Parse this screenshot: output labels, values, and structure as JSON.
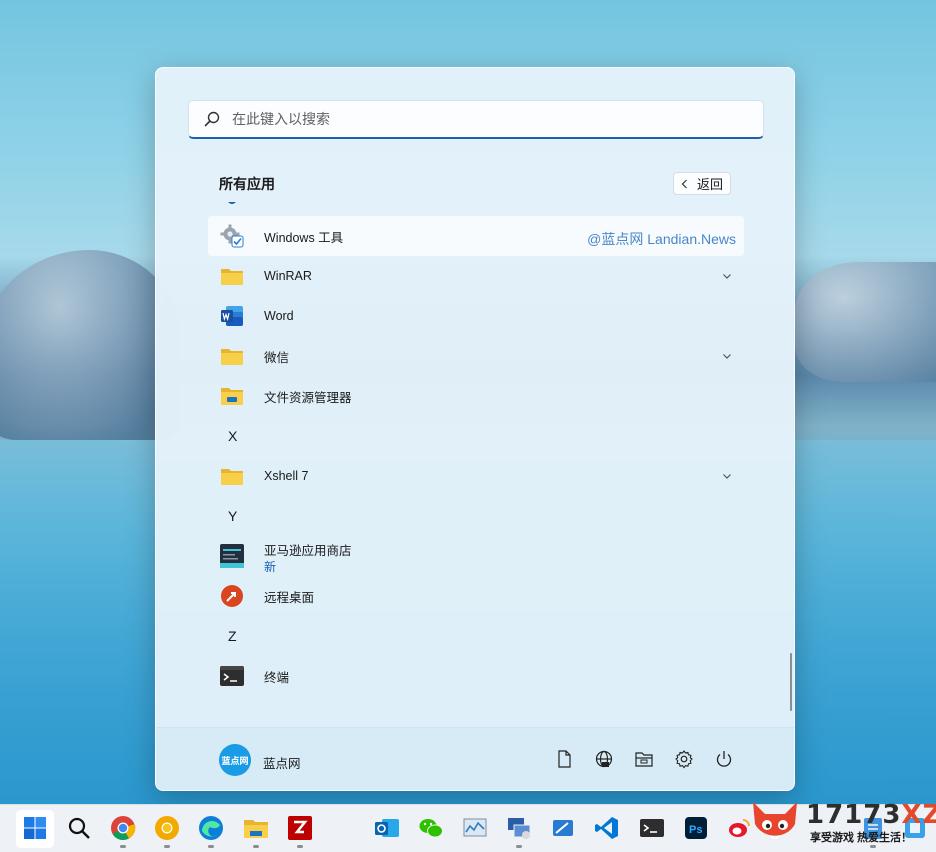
{
  "search": {
    "placeholder": "在此键入以搜索"
  },
  "all_apps": {
    "title": "所有应用",
    "back_label": "返回"
  },
  "apps": [
    {
      "label": "Windows 工具",
      "icon": "gear-tools-icon"
    },
    {
      "label": "WinRAR",
      "icon": "folder-icon",
      "expandable": true
    },
    {
      "label": "Word",
      "icon": "word-icon"
    },
    {
      "label": "微信",
      "icon": "folder-icon",
      "expandable": true
    },
    {
      "label": "文件资源管理器",
      "icon": "file-explorer-icon"
    },
    {
      "letter": "X"
    },
    {
      "label": "Xshell 7",
      "icon": "folder-icon",
      "expandable": true
    },
    {
      "letter": "Y"
    },
    {
      "label": "亚马逊应用商店",
      "sub": "新",
      "icon": "amazon-appstore-icon"
    },
    {
      "label": "远程桌面",
      "icon": "remote-desktop-icon"
    },
    {
      "letter": "Z"
    },
    {
      "label": "终端",
      "icon": "terminal-icon"
    }
  ],
  "watermark": "@蓝点网 Landian.News",
  "user": {
    "name": "蓝点网",
    "avatar_text": "蓝点网"
  },
  "footer_buttons": [
    "documents-icon",
    "network-icon",
    "file-explorer-icon",
    "settings-icon",
    "power-icon"
  ],
  "taskbar": [
    "windows-start-icon",
    "search-icon",
    "chrome-icon",
    "chrome-canary-icon",
    "edge-icon",
    "file-explorer-icon",
    "filezilla-icon",
    "outlook-icon",
    "wechat-icon",
    "resource-monitor-icon",
    "remote-connection-icon",
    "snip-icon",
    "vscode-icon",
    "terminal-icon",
    "photoshop-icon",
    "weibo-icon",
    "outlook-icon",
    "notepad-icon",
    "app-icon"
  ],
  "brand": {
    "number": "17173",
    "suffix": "XZ",
    "slogan": "享受游戏  热爱生活！"
  },
  "colors": {
    "accent": "#1d5fa8",
    "avatar": "#1a9be6",
    "new_badge": "#1a5fb4"
  }
}
